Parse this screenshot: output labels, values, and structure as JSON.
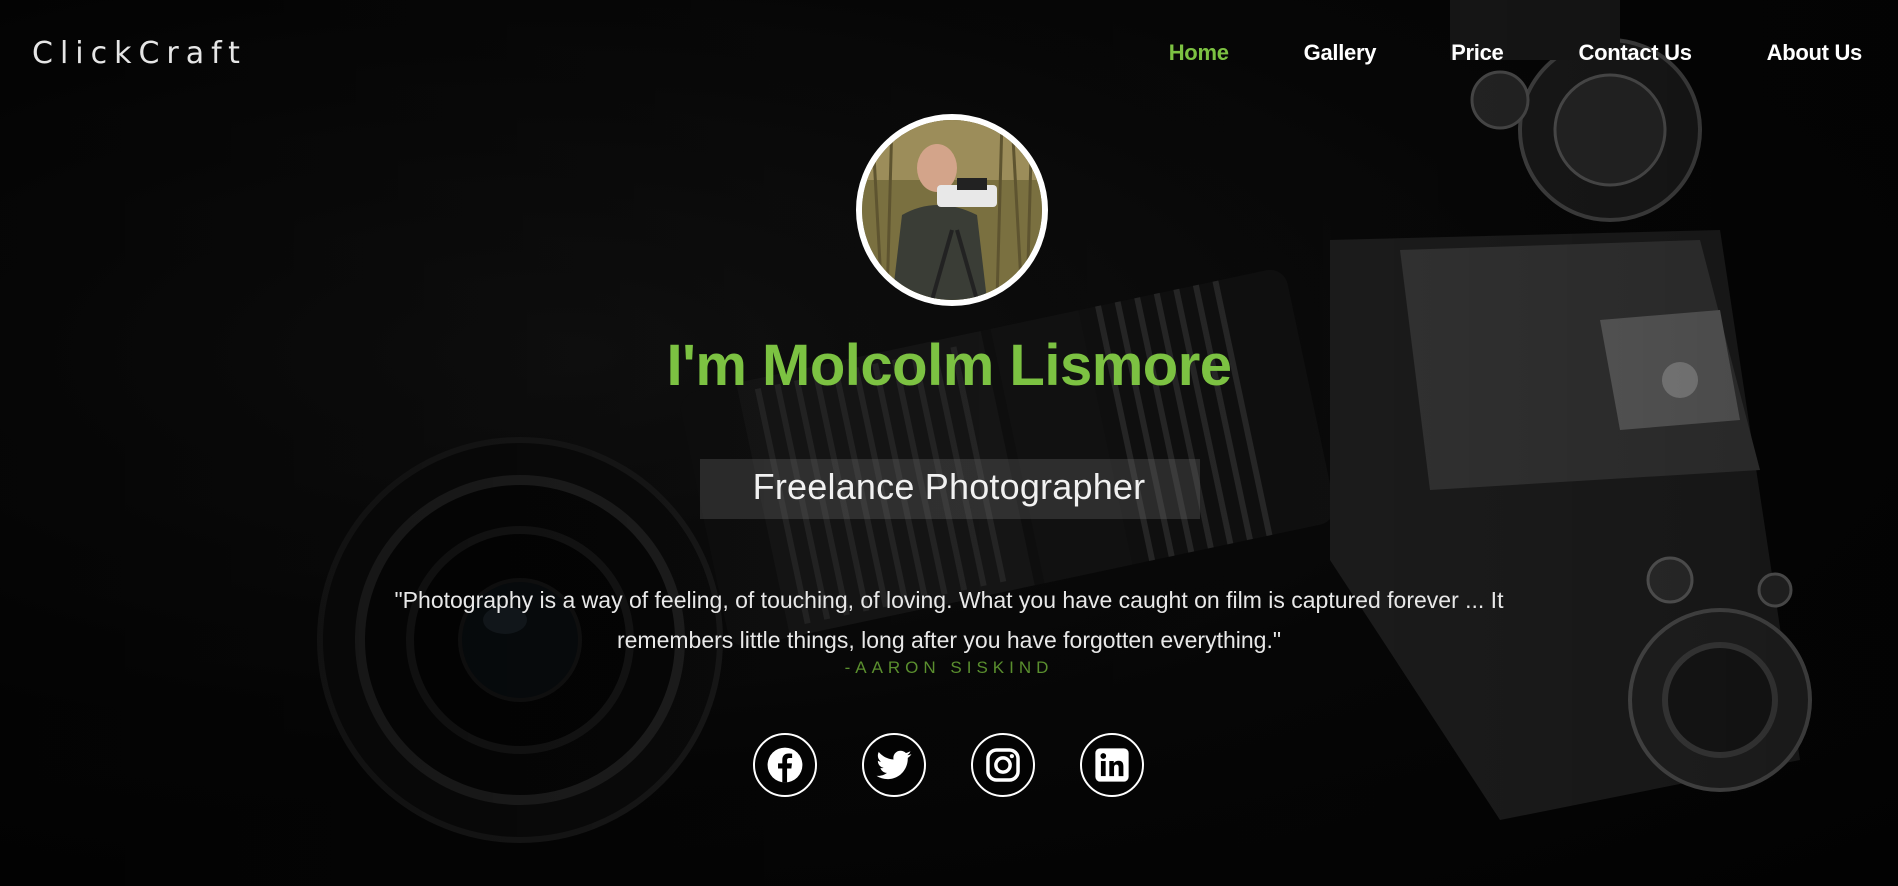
{
  "brand": {
    "name": "ClickCraft"
  },
  "nav": {
    "items": [
      {
        "label": "Home",
        "active": true
      },
      {
        "label": "Gallery",
        "active": false
      },
      {
        "label": "Price",
        "active": false
      },
      {
        "label": "Contact Us",
        "active": false
      },
      {
        "label": "About Us",
        "active": false
      }
    ]
  },
  "hero": {
    "headline": "I'm Molcolm Lismore",
    "subtitle": "Freelance Photographer",
    "quote": "\"Photography is a way of feeling, of touching, of loving. What you have caught on film is captured forever ... It remembers little things, long after you have forgotten everything.\"",
    "author": "-AARON SISKIND"
  },
  "socials": [
    {
      "icon": "facebook-icon"
    },
    {
      "icon": "twitter-icon"
    },
    {
      "icon": "instagram-icon"
    },
    {
      "icon": "linkedin-icon"
    }
  ],
  "colors": {
    "accent": "#7cc242",
    "author": "#5a8f2e",
    "background": "#050505"
  }
}
